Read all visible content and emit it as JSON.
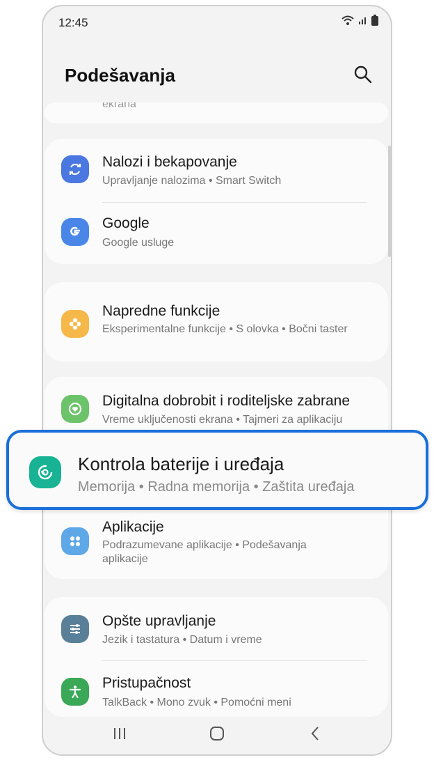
{
  "status_bar": {
    "time": "12:45"
  },
  "header": {
    "title": "Podešavanja"
  },
  "top_partial": {
    "text": "ekrana"
  },
  "cards": {
    "accounts": {
      "title": "Nalozi i bekapovanje",
      "subtitle": "Upravljanje nalozima  •  Smart Switch"
    },
    "google": {
      "title": "Google",
      "subtitle": "Google usluge"
    },
    "advanced": {
      "title": "Napredne funkcije",
      "subtitle": "Eksperimentalne funkcije  •  S olovka  •  Bočni taster"
    },
    "wellbeing": {
      "title": "Digitalna dobrobit i roditeljske zabrane",
      "subtitle": "Vreme uključenosti ekrana  •  Tajmeri za aplikaciju"
    },
    "apps": {
      "title": "Aplikacije",
      "subtitle": "Podrazumevane aplikacije  •  Podešavanja aplikacije"
    },
    "general": {
      "title": "Opšte upravljanje",
      "subtitle": "Jezik i tastatura  •  Datum i vreme"
    },
    "accessibility": {
      "title": "Pristupačnost",
      "subtitle": "TalkBack  •  Mono zvuk  •  Pomoćni meni"
    }
  },
  "highlight": {
    "title": "Kontrola baterije i uređaja",
    "subtitle": "Memorija  •  Radna memorija  •  Zaštita uređaja",
    "border_color": "#1a6fd8"
  },
  "icons": {
    "accounts": "sync-icon",
    "google": "google-icon",
    "advanced": "puzzle-icon",
    "wellbeing": "heart-circle-icon",
    "device_care": "device-care-icon",
    "apps": "apps-grid-icon",
    "general": "sliders-icon",
    "accessibility": "accessibility-icon"
  },
  "colors": {
    "accounts": "#4a78e0",
    "google": "#4a86e8",
    "advanced": "#f7b84a",
    "wellbeing": "#6cc36a",
    "device_care": "#17b394",
    "apps": "#5fa8e8",
    "general": "#5a7f99",
    "accessibility": "#3aa856"
  }
}
